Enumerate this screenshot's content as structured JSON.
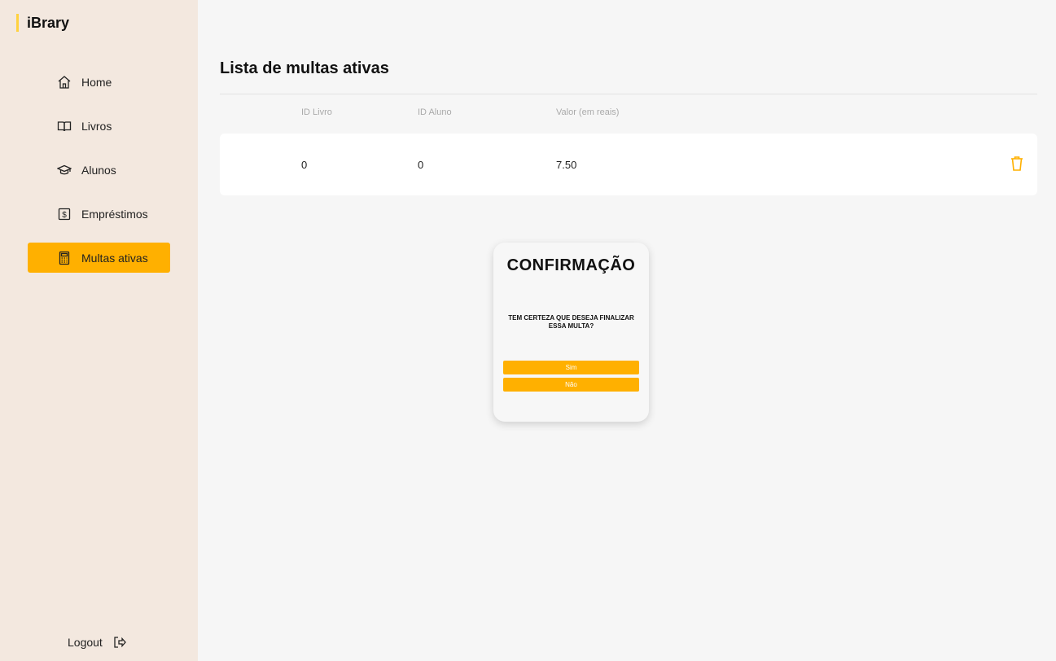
{
  "brand": {
    "name": "iBrary",
    "accent": "#ffd23f"
  },
  "sidebar": {
    "items": [
      {
        "label": "Home",
        "icon": "home-icon",
        "active": false
      },
      {
        "label": "Livros",
        "icon": "book-icon",
        "active": false
      },
      {
        "label": "Alunos",
        "icon": "graduation-cap-icon",
        "active": false
      },
      {
        "label": "Empréstimos",
        "icon": "money-icon",
        "active": false
      },
      {
        "label": "Multas ativas",
        "icon": "calculator-icon",
        "active": true
      }
    ],
    "logout_label": "Logout"
  },
  "main": {
    "title": "Lista de multas ativas",
    "columns": [
      "ID Livro",
      "ID Aluno",
      "Valor (em reais)"
    ],
    "rows": [
      {
        "id_livro": "0",
        "id_aluno": "0",
        "valor": "7.50"
      }
    ]
  },
  "modal": {
    "title": "CONFIRMAÇÃO",
    "message": "TEM CERTEZA QUE DESEJA FINALIZAR ESSA MULTA?",
    "yes_label": "Sim",
    "no_label": "Não"
  },
  "colors": {
    "accent": "#ffb000",
    "sidebar_bg": "#f3e8df",
    "page_bg": "#f6f6f6"
  }
}
